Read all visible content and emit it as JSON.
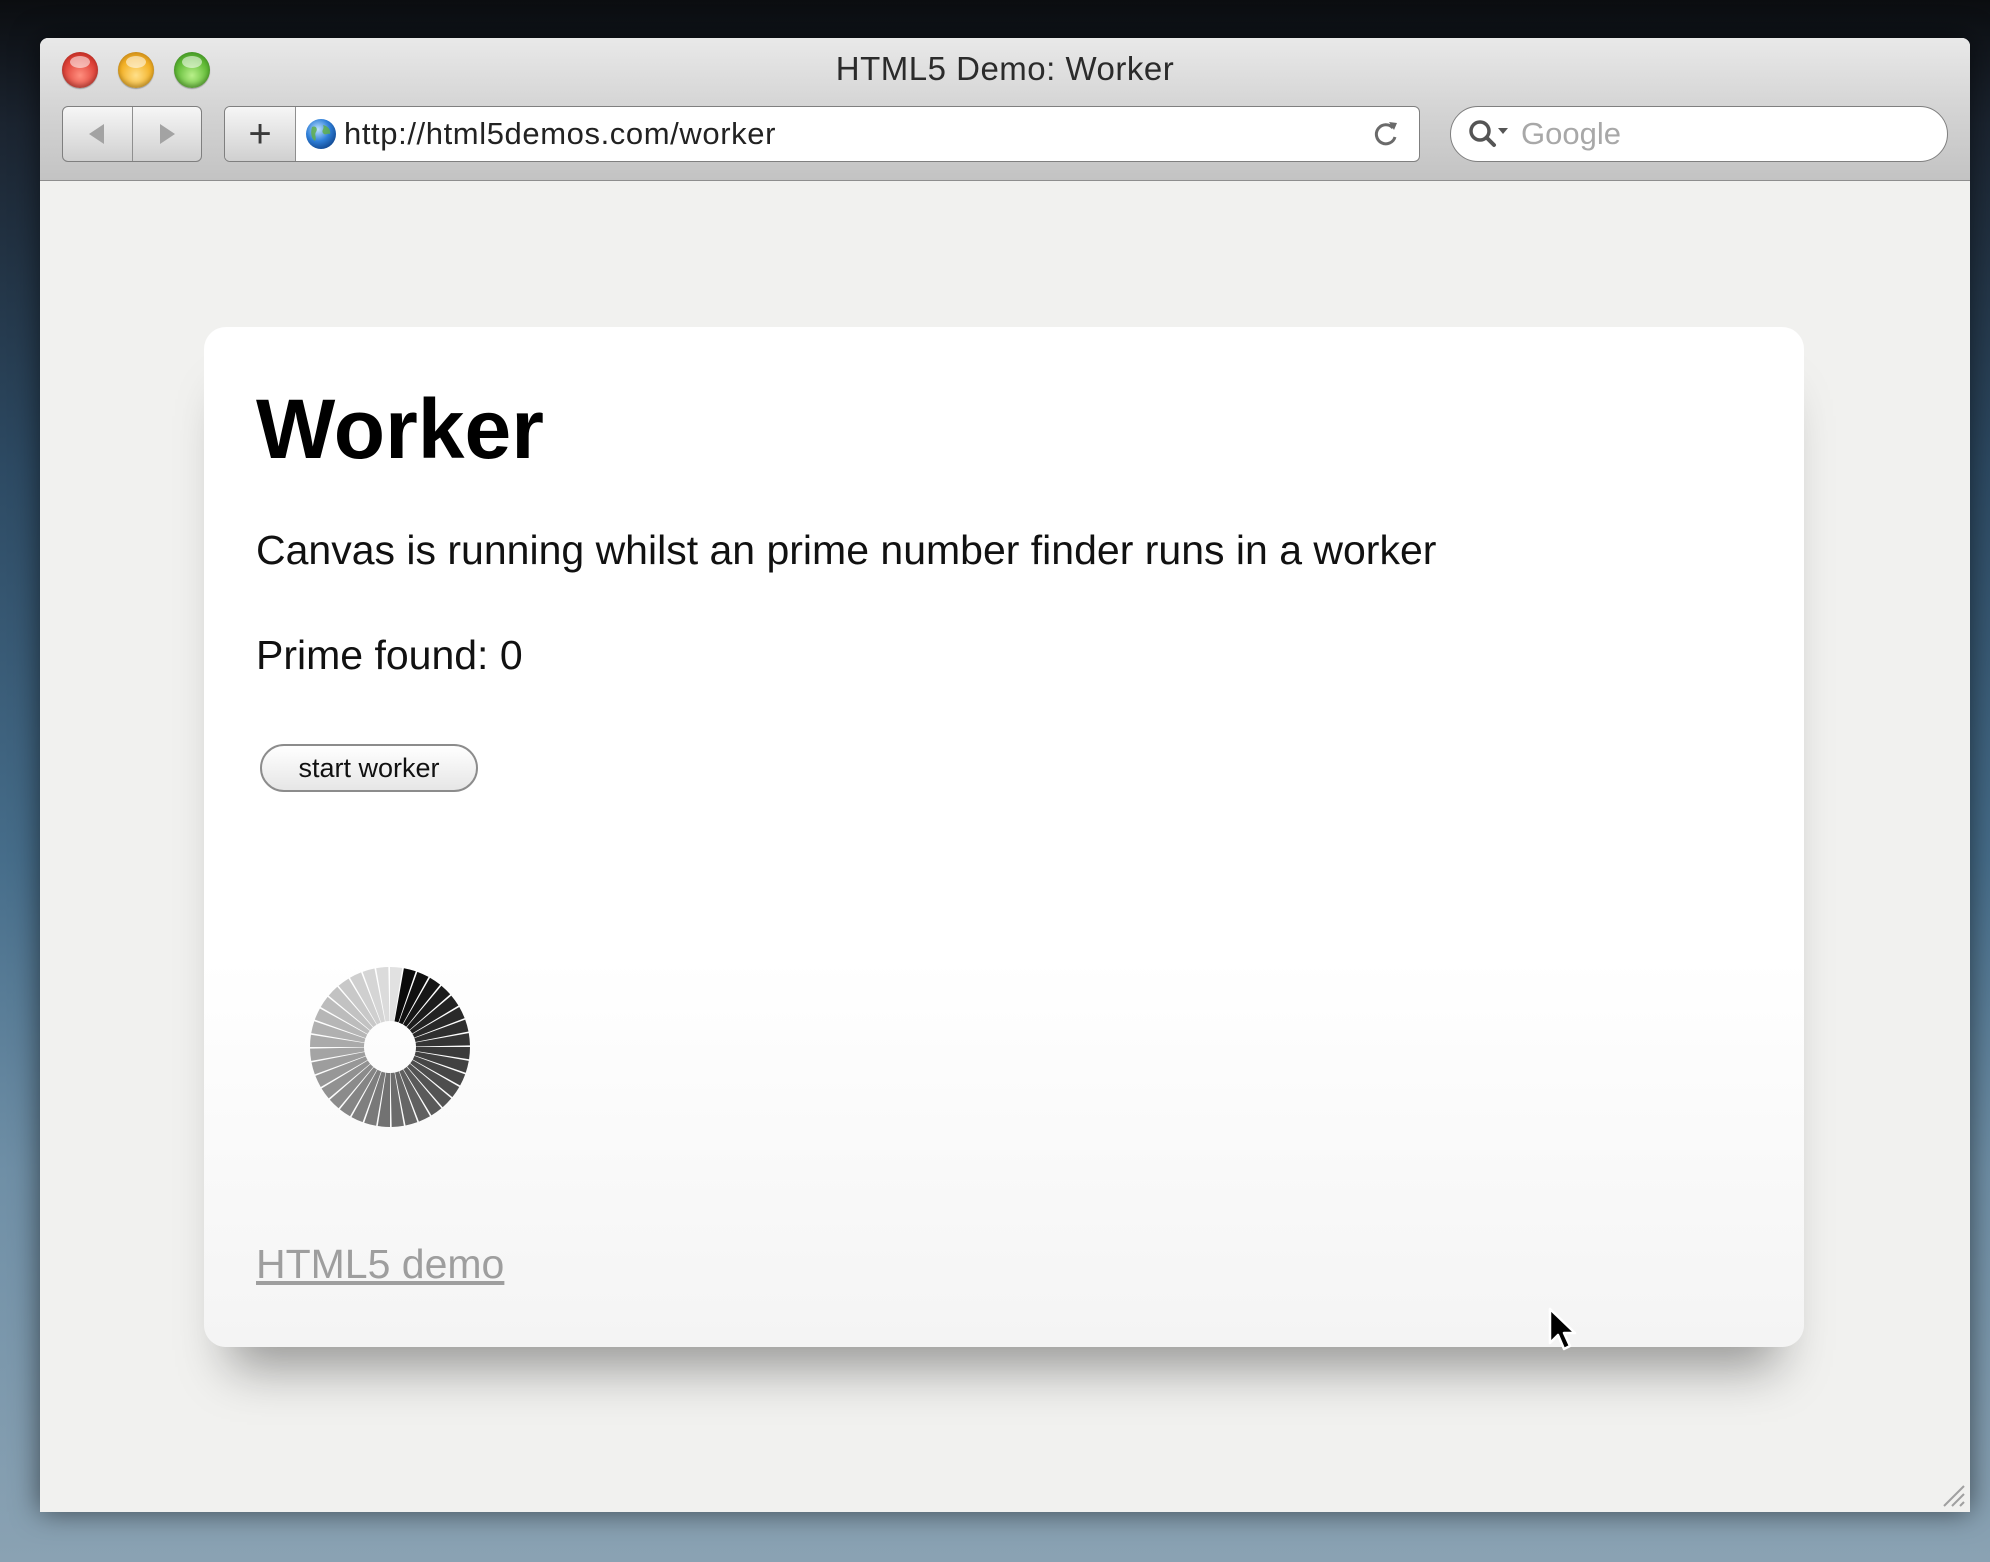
{
  "window": {
    "title": "HTML5 Demo: Worker"
  },
  "toolbar": {
    "back_icon": "back-arrow-icon",
    "forward_icon": "forward-arrow-icon",
    "add_label": "+",
    "url": "http://html5demos.com/worker",
    "search_placeholder": "Google"
  },
  "page": {
    "title": "Worker",
    "description": "Canvas is running whilst an prime number finder runs in a worker",
    "prime_label": "Prime found: 0",
    "start_button_label": "start worker",
    "footer_link": "HTML5 demo"
  },
  "colors": {
    "close": "#e0443a",
    "minimize": "#f3b126",
    "maximize": "#61bb36",
    "link": "#9e9e9e"
  }
}
